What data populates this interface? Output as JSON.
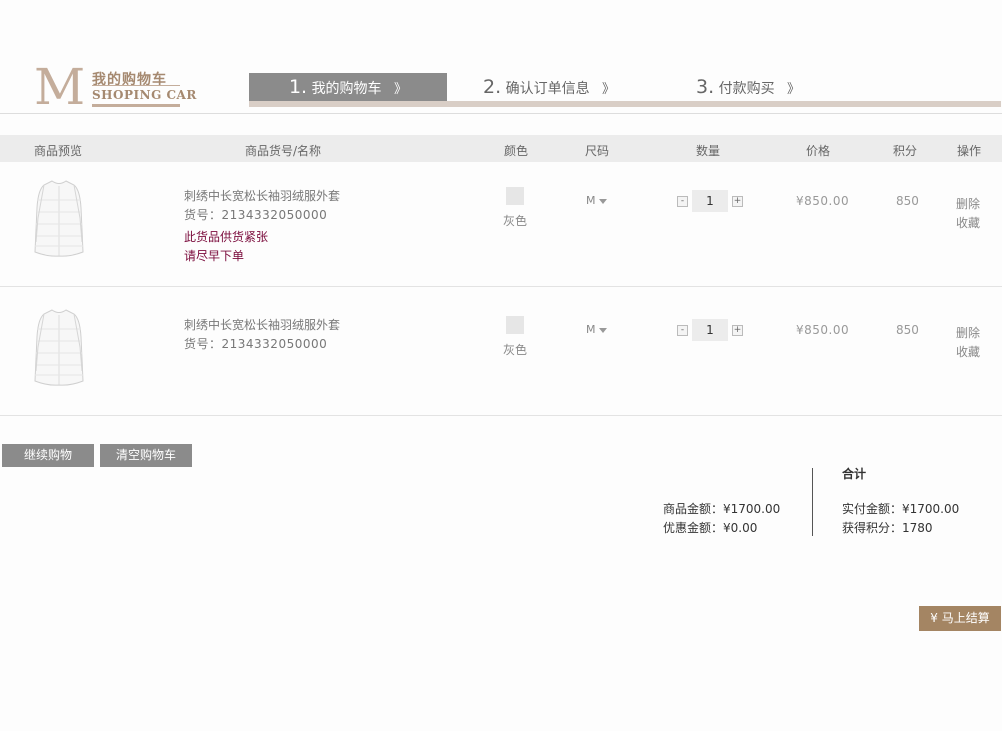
{
  "logo": {
    "mark": "M",
    "title": "我的购物车",
    "subtitle": "SHOPING CAR"
  },
  "steps": [
    {
      "num": "1.",
      "label": "我的购物车",
      "arrow": "》",
      "active": true
    },
    {
      "num": "2.",
      "label": "确认订单信息",
      "arrow": "》",
      "active": false
    },
    {
      "num": "3.",
      "label": "付款购买",
      "arrow": "》",
      "active": false
    }
  ],
  "table_headers": {
    "preview": "商品预览",
    "sku_name": "商品货号/名称",
    "color": "颜色",
    "size": "尺码",
    "quantity": "数量",
    "price": "价格",
    "points": "积分",
    "actions": "操作"
  },
  "items": [
    {
      "name": "刺绣中长宽松长袖羽绒服外套",
      "sku": "货号：2134332050000",
      "warning": [
        "此货品供货紧张",
        "请尽早下单"
      ],
      "color": "灰色",
      "size": "M",
      "quantity": "1",
      "price": "¥850.00",
      "points": "850",
      "delete_label": "删除",
      "favorite_label": "收藏"
    },
    {
      "name": "刺绣中长宽松长袖羽绒服外套",
      "sku": "货号：2134332050000",
      "warning": [],
      "color": "灰色",
      "size": "M",
      "quantity": "1",
      "price": "¥850.00",
      "points": "850",
      "delete_label": "删除",
      "favorite_label": "收藏"
    }
  ],
  "qty_controls": {
    "minus": "-",
    "plus": "+"
  },
  "buttons": {
    "continue_shopping": "继续购物",
    "clear_cart": "清空购物车",
    "checkout": "¥ 马上结算"
  },
  "summary": {
    "goods_amount": "商品金额：¥1700.00",
    "discount_amount": "优惠金额：¥0.00",
    "total_title": "合计",
    "paid_amount": "实付金额：¥1700.00",
    "points_earned": "获得积分：1780"
  },
  "colors": {
    "accent_gold": "#a48563",
    "active_step": "#8b8b8b",
    "warning": "#7a0a3b",
    "logo": "#c4ad9b"
  }
}
